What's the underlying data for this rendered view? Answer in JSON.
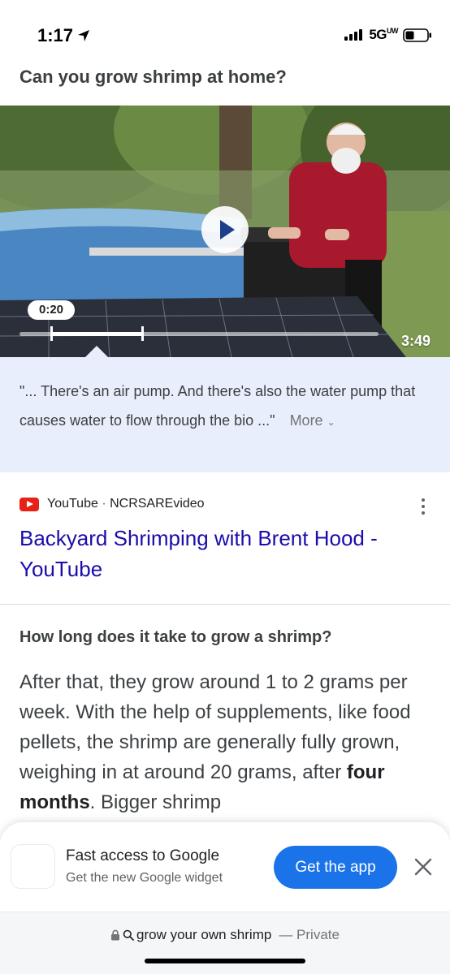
{
  "status_bar": {
    "time": "1:17",
    "network": "5G",
    "network_suffix": "UW"
  },
  "question": "Can you grow shrimp at home?",
  "video": {
    "current_time": "0:20",
    "duration": "3:49",
    "progress_fraction": 0.09,
    "segment_end_fraction": 0.34
  },
  "transcript": {
    "text": "\"... There's an air pump. And there's also the water pump that causes water to flow through the bio ...\"",
    "more_label": "More"
  },
  "source": {
    "site": "YouTube",
    "channel": "NCRSAREvideo",
    "separator": " · "
  },
  "result_title": "Backyard Shrimping with Brent Hood - YouTube",
  "faq": {
    "question": "How long does it take to grow a shrimp?",
    "answer_before": "After that, they grow around 1 to 2 grams per week. With the help of supplements, like food pellets, the shrimp are generally fully grown, weighing in at around 20 grams, after ",
    "answer_bold": "four months",
    "answer_after": ". Bigger shrimp"
  },
  "promo": {
    "title": "Fast access to Google",
    "subtitle": "Get the new Google widget",
    "button": "Get the app"
  },
  "address_bar": {
    "query": "grow your own shrimp",
    "dash": "—",
    "mode": "Private"
  },
  "colors": {
    "link": "#1a0dab",
    "accent": "#1a73e8",
    "transcript_bg": "#e8eefb",
    "youtube_red": "#e62117"
  }
}
